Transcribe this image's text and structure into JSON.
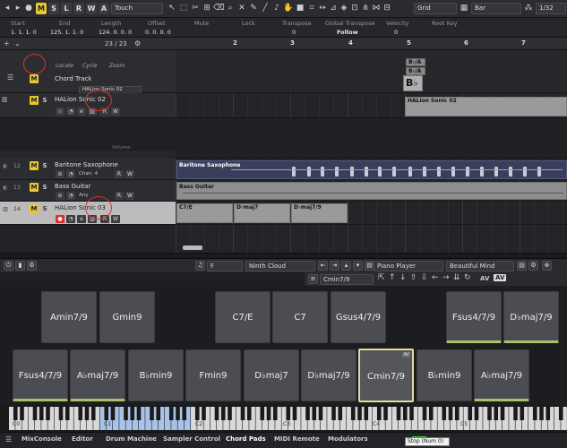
{
  "toolbar": {
    "buttons": [
      "M",
      "S",
      "L",
      "R",
      "W",
      "A"
    ],
    "automation_mode": "Touch",
    "snap_mode": "Grid",
    "grid_type": "Bar",
    "quantize": "1/32",
    "chevron": "▾"
  },
  "info_line": {
    "headers": [
      "Start",
      "End",
      "Length",
      "Offset",
      "Mute",
      "Lock",
      "Transpose",
      "Global Transpose",
      "Velocity",
      "Root Key"
    ],
    "values": [
      "1. 1. 1. 0",
      "125. 1. 1. 0",
      "124. 0. 0. 0",
      "0. 0. 0. 0",
      "",
      "",
      "0",
      "Follow",
      "0",
      ""
    ]
  },
  "track_list": {
    "counter": "23 / 23",
    "chord_track": {
      "name": "Chord Track",
      "locate": "Locate",
      "cycle": "Cycle",
      "zoom": "Zoom",
      "instrument": "HALion Sonic 02"
    },
    "tracks": [
      {
        "num": "",
        "name": "HALion Sonic 02"
      },
      {
        "num": "12",
        "name": "Baritone Saxophone",
        "sub": "Chan. 4"
      },
      {
        "num": "13",
        "name": "Bass Guitar",
        "sub": "Any"
      },
      {
        "num": "14",
        "name": "HALion Sonic 03"
      }
    ],
    "volume_label": "Volume"
  },
  "ruler": {
    "bars": [
      "2",
      "3",
      "4",
      "5",
      "6",
      "7"
    ]
  },
  "project": {
    "chord_events": [
      "B♭/A",
      "B♭/A"
    ],
    "chord_symbol": "B♭",
    "halion02_part": "HALion Sonic 02",
    "sax_part": "Baritone Saxophone",
    "bass_part": "Bass Guitar",
    "halion03_parts": [
      "C7/E",
      "D♭maj7",
      "D♭maj7/9"
    ]
  },
  "chord_pads": {
    "key": "F",
    "voicing_preset": "Ninth Cloud",
    "player": "Piano Player",
    "pattern": "Beautiful Mind",
    "current_chord": "Cmin7/9",
    "av_labels": [
      "AV",
      "AV"
    ],
    "row1": [
      "Amin7/9",
      "Gmin9",
      "C7/E",
      "C7",
      "Gsus4/7/9",
      "Fsus4/7/9",
      "D♭maj7/9"
    ],
    "row2": [
      "Fsus4/7/9",
      "A♭maj7/9",
      "B♭min9",
      "Fmin9",
      "D♭maj7",
      "D♭maj7/9",
      "Cmin7/9",
      "B♭min9",
      "A♭maj7/9"
    ],
    "active_badge": "AV"
  },
  "keyboard": {
    "octaves": [
      "C0",
      "C1",
      "C2",
      "C3",
      "C4",
      "C5"
    ]
  },
  "tabs": [
    "MixConsole",
    "Editor",
    "Drum Machine",
    "Sampler Control",
    "Chord Pads",
    "MIDI Remote",
    "Modulators"
  ],
  "tooltip": "Stop (Num 0)",
  "colors": {
    "mute": "#e8c733",
    "record": "#e03030",
    "indicator": "#a9c36a",
    "active_pad": "#e3dc9c"
  }
}
